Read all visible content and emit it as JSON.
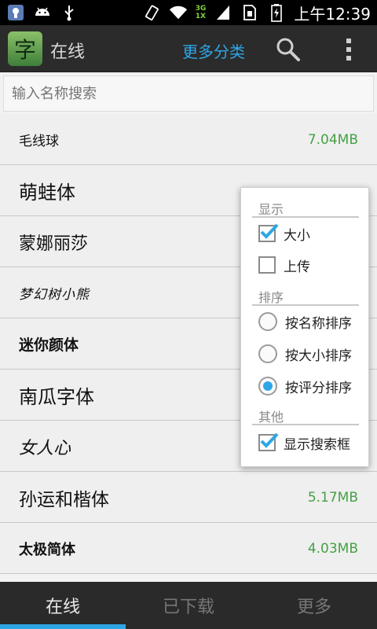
{
  "status_bar": {
    "time": "上午12:39",
    "network": [
      "3G",
      "1X"
    ],
    "icons": [
      "usb-debug-icon",
      "android-icon",
      "usb-icon",
      "vibrate-icon",
      "wifi-icon",
      "signal-icon",
      "sim-icon",
      "battery-charging-icon"
    ]
  },
  "action_bar": {
    "logo_glyph": "字",
    "title": "在线",
    "more_categories": "更多分类",
    "icons": [
      "search-icon",
      "overflow-menu-icon"
    ]
  },
  "search": {
    "placeholder": "输入名称搜索"
  },
  "fonts": [
    {
      "name": "毛线球",
      "size": "7.04MB"
    },
    {
      "name": "萌蛙体",
      "size": ""
    },
    {
      "name": "蒙娜丽莎",
      "size": ""
    },
    {
      "name": "梦幻树小熊",
      "size": ""
    },
    {
      "name": "迷你颜体",
      "size": ""
    },
    {
      "name": "南瓜字体",
      "size": ""
    },
    {
      "name": "女人心",
      "size": ""
    },
    {
      "name": "孙运和楷体",
      "size": "5.17MB"
    },
    {
      "name": "太极简体",
      "size": "4.03MB"
    }
  ],
  "menu": {
    "display_title": "显示",
    "size_label": "大小",
    "upload_label": "上传",
    "sort_title": "排序",
    "sort_name": "按名称排序",
    "sort_size": "按大小排序",
    "sort_rating": "按评分排序",
    "other_title": "其他",
    "show_search": "显示搜索框",
    "checked": {
      "size": true,
      "upload": false,
      "show_search": true
    },
    "selected_sort": "rating"
  },
  "tabs": {
    "online": "在线",
    "downloaded": "已下载",
    "more": "更多",
    "active": "online"
  },
  "colors": {
    "accent": "#2ea6e6",
    "size_text": "#46a046",
    "bar_bg": "#2b2b2b"
  }
}
